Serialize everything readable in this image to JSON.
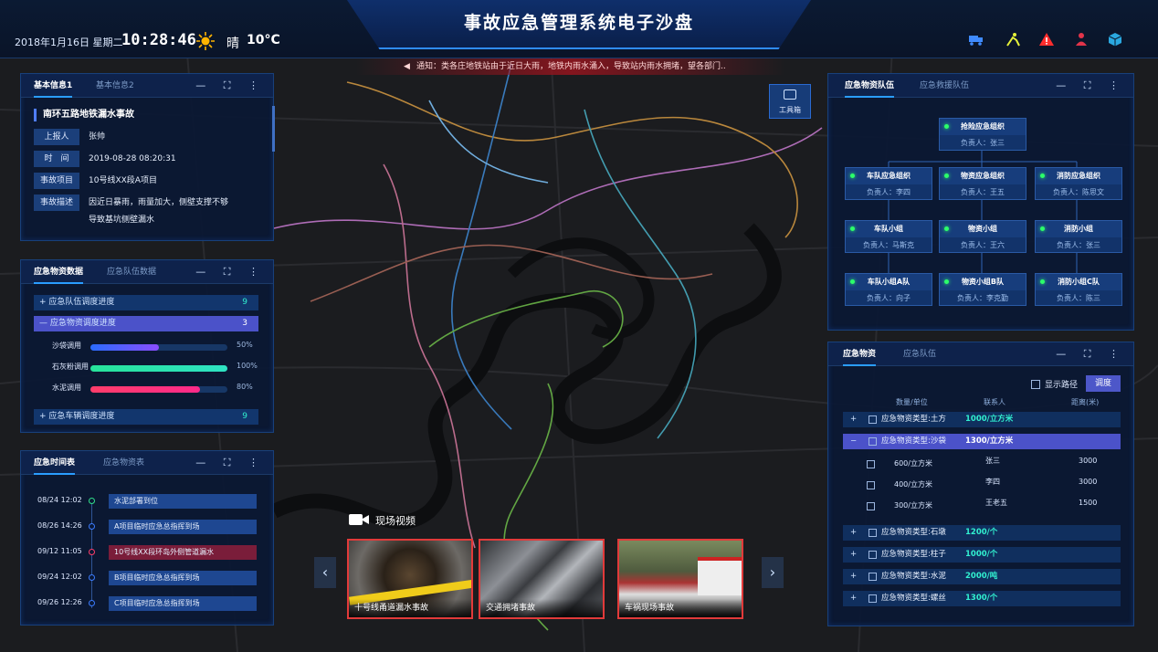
{
  "header": {
    "title": "事故应急管理系统电子沙盘",
    "date": "2018年1月16日 星期二",
    "time": "10:28:46",
    "weather": "晴",
    "temperature": "10°C",
    "icons": [
      "truck-icon",
      "worker-icon",
      "warning-icon",
      "person-icon",
      "cube-icon"
    ]
  },
  "notice": {
    "text": "通知：类各庄地铁站由于近日大雨，地铁内雨水涌入，导致站内雨水拥堵，望各部门.."
  },
  "toolbox": {
    "label": "工具箱"
  },
  "basic": {
    "tabs": [
      "基本信息1",
      "基本信息2"
    ],
    "title": "南环五路地铁漏水事故",
    "rows": [
      {
        "label": "上报人",
        "value": "张帅"
      },
      {
        "label": "时　间",
        "value": "2019-08-28  08:20:31"
      },
      {
        "label": "事故项目",
        "value": "10号线XX段A项目"
      },
      {
        "label": "事故描述",
        "value": "因近日暴雨，雨量加大，侧壁支撑不够"
      }
    ],
    "desc_cont": "导致基坑侧壁漏水"
  },
  "supply": {
    "tabs": [
      "应急物资数据",
      "应急队伍数据"
    ],
    "acc": [
      {
        "sign": "+",
        "label": "应急队伍调度进度",
        "count": "9"
      },
      {
        "sign": "—",
        "label": "应急物资调度进度",
        "count": "3"
      },
      {
        "sign": "+",
        "label": "应急车辆调度进度",
        "count": "9"
      }
    ],
    "bars": [
      {
        "label": "沙袋调用",
        "value": 50,
        "text": "50%"
      },
      {
        "label": "石灰粉调用",
        "value": 100,
        "text": "100%"
      },
      {
        "label": "水泥调用",
        "value": 80,
        "text": "80%"
      }
    ]
  },
  "timeline": {
    "tabs": [
      "应急时间表",
      "应急物资表"
    ],
    "items": [
      {
        "time": "08/24  12:02",
        "text": "水泥部署到位"
      },
      {
        "time": "08/26  14:26",
        "text": "A项目临时应急总指挥到场"
      },
      {
        "time": "09/12  11:05",
        "text": "10号线XX段环岛外侧管道漏水"
      },
      {
        "time": "09/24  12:02",
        "text": "B项目临时应急总指挥到场"
      },
      {
        "time": "09/26  12:26",
        "text": "C项目临时应急总指挥到场"
      }
    ]
  },
  "video": {
    "title": "现场视频",
    "items": [
      {
        "caption": "十号线甬道漏水事故"
      },
      {
        "caption": "交通拥堵事故"
      },
      {
        "caption": "车祸现场事故"
      }
    ]
  },
  "team": {
    "tabs": [
      "应急物资队伍",
      "应急救援队伍"
    ],
    "root": {
      "name": "抢险应急组织",
      "lead": "负责人：张三"
    },
    "level2": [
      {
        "name": "车队应急组织",
        "lead": "负责人：李四"
      },
      {
        "name": "物资应急组织",
        "lead": "负责人：王五"
      },
      {
        "name": "消防应急组织",
        "lead": "负责人：陈思文"
      }
    ],
    "level3": [
      {
        "name": "车队小组",
        "lead": "负责人：马斯克"
      },
      {
        "name": "物资小组",
        "lead": "负责人：王六"
      },
      {
        "name": "消防小组",
        "lead": "负责人：张三"
      }
    ],
    "level4": [
      {
        "name": "车队小组A队",
        "lead": "负责人：向子"
      },
      {
        "name": "物资小组B队",
        "lead": "负责人：李克勤"
      },
      {
        "name": "消防小组C队",
        "lead": "负责人：陈三"
      }
    ]
  },
  "mat": {
    "tabs": [
      "应急物资",
      "应急队伍"
    ],
    "show_route": "显示路径",
    "dispatch": "调度",
    "cols": [
      "数量/单位",
      "联系人",
      "距离(米)"
    ],
    "rows": [
      {
        "sign": "+",
        "name": "应急物资类型:土方",
        "qty": "1000/立方米"
      },
      {
        "sign": "−",
        "name": "应急物资类型:沙袋",
        "qty": "1300/立方米"
      }
    ],
    "subs": [
      {
        "qty": "600/立方米",
        "contact": "张三",
        "dist": "3000"
      },
      {
        "qty": "400/立方米",
        "contact": "李四",
        "dist": "3000"
      },
      {
        "qty": "300/立方米",
        "contact": "王老五",
        "dist": "1500"
      }
    ],
    "rows2": [
      {
        "sign": "+",
        "name": "应急物资类型:石墩",
        "qty": "1200/个"
      },
      {
        "sign": "+",
        "name": "应急物资类型:柱子",
        "qty": "1000/个"
      },
      {
        "sign": "+",
        "name": "应急物资类型:水泥",
        "qty": "2000/吨"
      },
      {
        "sign": "+",
        "name": "应急物资类型:螺丝",
        "qty": "1300/个"
      }
    ]
  },
  "colors": {
    "accent": "#2a9dff",
    "panel": "#0a1834",
    "alert": "#e23a3a",
    "progress1": "#3b6cff",
    "progress2": "#27e39a",
    "progress3": "#ff3d6a"
  }
}
